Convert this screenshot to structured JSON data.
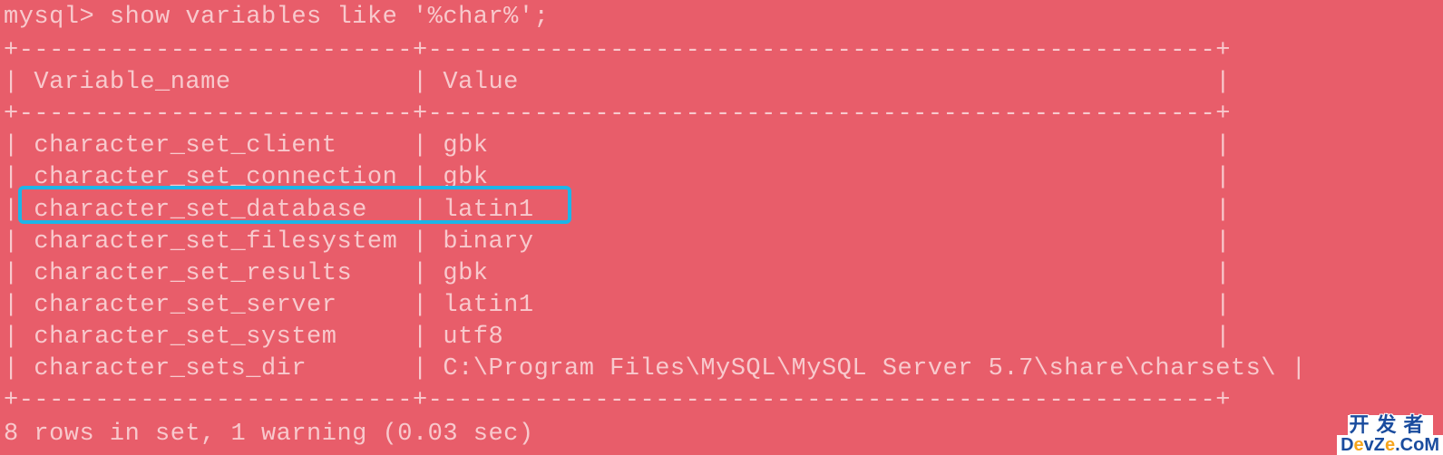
{
  "prompt": "mysql> show variables like '%char%';",
  "table": {
    "border_top": "+--------------------------+----------------------------------------------------+",
    "border_mid": "+--------------------------+----------------------------------------------------+",
    "border_bottom": "+--------------------------+----------------------------------------------------+",
    "header": "| Variable_name            | Value                                              |",
    "rows": [
      "| character_set_client     | gbk                                                |",
      "| character_set_connection | gbk                                                |",
      "| character_set_database   | latin1                                             |",
      "| character_set_filesystem | binary                                             |",
      "| character_set_results    | gbk                                                |",
      "| character_set_server     | latin1                                             |",
      "| character_set_system     | utf8                                               |",
      "| character_sets_dir       | C:\\Program Files\\MySQL\\MySQL Server 5.7\\share\\charsets\\ |"
    ]
  },
  "footer": "8 rows in set, 1 warning (0.03 sec)",
  "highlight": {
    "row_index": 2,
    "variable": "character_set_database",
    "value": "latin1"
  },
  "watermark": {
    "cn": "开发者",
    "en_prefix": "D",
    "en_e1": "e",
    "en_mid": "vZ",
    "en_e2": "e",
    "en_suffix": ".CoM"
  },
  "chart_data": {
    "type": "table",
    "title": "MySQL character variables",
    "columns": [
      "Variable_name",
      "Value"
    ],
    "rows": [
      [
        "character_set_client",
        "gbk"
      ],
      [
        "character_set_connection",
        "gbk"
      ],
      [
        "character_set_database",
        "latin1"
      ],
      [
        "character_set_filesystem",
        "binary"
      ],
      [
        "character_set_results",
        "gbk"
      ],
      [
        "character_set_server",
        "latin1"
      ],
      [
        "character_set_system",
        "utf8"
      ],
      [
        "character_sets_dir",
        "C:\\Program Files\\MySQL\\MySQL Server 5.7\\share\\charsets\\"
      ]
    ]
  }
}
